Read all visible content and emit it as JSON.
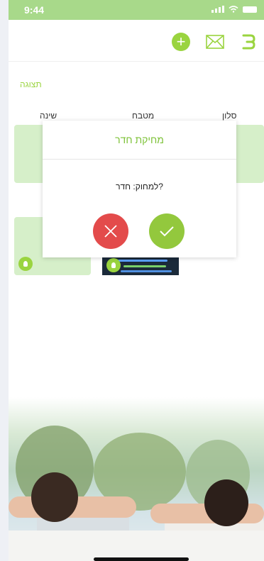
{
  "status_bar": {
    "time": "9:44"
  },
  "toolbar": {
    "add_icon": "plus-icon",
    "mail_icon": "envelope-icon",
    "menu_icon": "menu-icon"
  },
  "section": {
    "label": "תצוגה"
  },
  "rooms": [
    {
      "label": "סלון"
    },
    {
      "label": "מטבח"
    },
    {
      "label": "שינה"
    }
  ],
  "dialog": {
    "title": "מחיקת חדר",
    "message": "למחוק: חדר?",
    "cancel_icon": "close-icon",
    "confirm_icon": "check-icon"
  },
  "colors": {
    "accent": "#9ad43f",
    "status_bar": "#a8d98a",
    "cancel": "#e34b4b",
    "confirm": "#93c83d"
  }
}
